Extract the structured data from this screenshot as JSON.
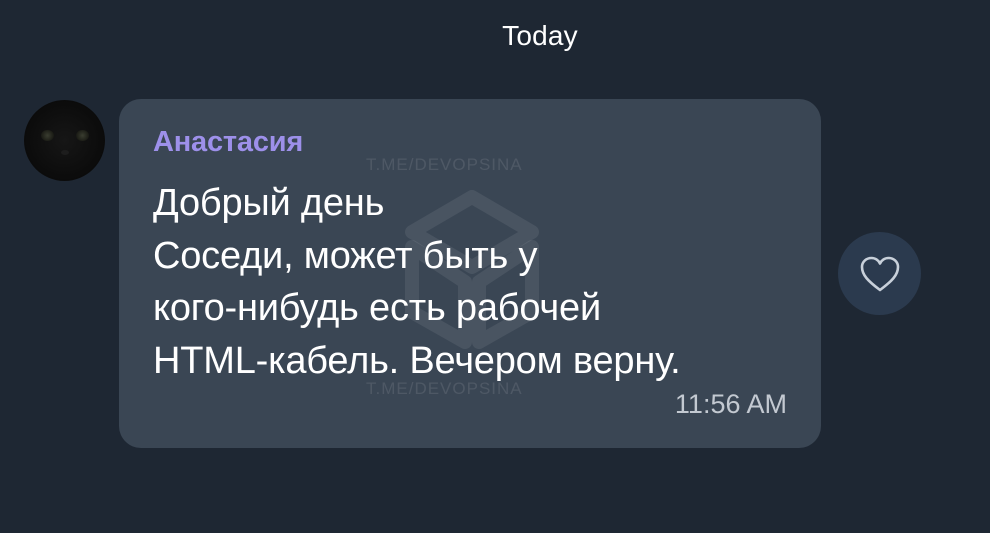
{
  "chat": {
    "date_label": "Today"
  },
  "message": {
    "sender": "Анастасия",
    "lines": [
      "Добрый день",
      "Соседи, может быть у",
      "кого-нибудь есть рабочей",
      "HTML-кабель. Вечером верну."
    ],
    "time": "11:56 AM",
    "watermark": "T.ME/DEVOPSINA"
  },
  "icons": {
    "avatar": "black-cat-avatar",
    "reaction": "heart-icon"
  },
  "colors": {
    "background": "#1e2733",
    "bubble": "#3a4654",
    "sender": "#9d90ea",
    "reaction_button": "#2b3a4e"
  }
}
